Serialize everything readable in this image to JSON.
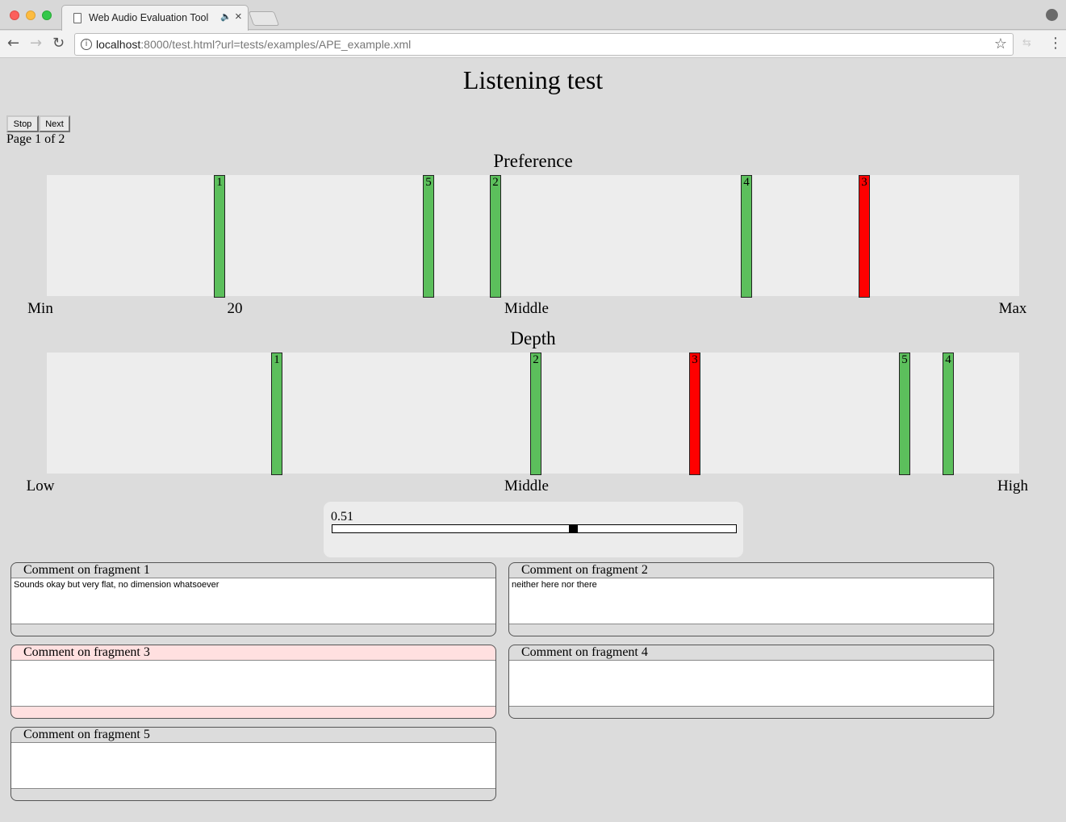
{
  "browser": {
    "tab_title": "Web Audio Evaluation Tool",
    "url_host": "localhost",
    "url_rest": ":8000/test.html?url=tests/examples/APE_example.xml",
    "icons": [
      "document-icon",
      "speaker-icon",
      "close-icon",
      "back-arrow-icon",
      "forward-arrow-icon",
      "reload-icon",
      "info-icon",
      "star-icon",
      "extension-icon",
      "menu-icon",
      "profile-icon"
    ]
  },
  "page": {
    "title": "Listening test",
    "stop_label": "Stop",
    "next_label": "Next",
    "page_counter": "Page 1 of 2"
  },
  "axes": [
    {
      "title": "Preference",
      "scale_labels": [
        {
          "text": "Min",
          "position": 0.0
        },
        {
          "text": "20",
          "position": 0.2
        },
        {
          "text": "Middle",
          "position": 0.5
        },
        {
          "text": "Max",
          "position": 1.0
        }
      ],
      "markers": [
        {
          "label": "1",
          "value": 0.174,
          "selected": false
        },
        {
          "label": "5",
          "value": 0.391,
          "selected": false
        },
        {
          "label": "2",
          "value": 0.461,
          "selected": false
        },
        {
          "label": "4",
          "value": 0.722,
          "selected": false
        },
        {
          "label": "3",
          "value": 0.845,
          "selected": true
        }
      ]
    },
    {
      "title": "Depth",
      "scale_labels": [
        {
          "text": "Low",
          "position": 0.0
        },
        {
          "text": "Middle",
          "position": 0.5
        },
        {
          "text": "High",
          "position": 1.0
        }
      ],
      "markers": [
        {
          "label": "1",
          "value": 0.233,
          "selected": false
        },
        {
          "label": "2",
          "value": 0.503,
          "selected": false
        },
        {
          "label": "3",
          "value": 0.668,
          "selected": true
        },
        {
          "label": "5",
          "value": 0.887,
          "selected": false
        },
        {
          "label": "4",
          "value": 0.932,
          "selected": false
        }
      ]
    }
  ],
  "value_slider": {
    "readout": "0.51",
    "value": 0.6
  },
  "comments": [
    {
      "label": "Comment on fragment 1",
      "text": "Sounds okay but very flat, no dimension whatsoever",
      "flagged": false
    },
    {
      "label": "Comment on fragment 2",
      "text": "neither here nor there",
      "flagged": false
    },
    {
      "label": "Comment on fragment 3",
      "text": "",
      "flagged": true
    },
    {
      "label": "Comment on fragment 4",
      "text": "",
      "flagged": false
    },
    {
      "label": "Comment on fragment 5",
      "text": "",
      "flagged": false
    }
  ],
  "colors": {
    "marker": "#5cbf5c",
    "marker_selected": "#ff0000",
    "flagged_comment": "#ffe0e0",
    "page_bg": "#dcdcdc",
    "track_bg": "#ededed"
  }
}
